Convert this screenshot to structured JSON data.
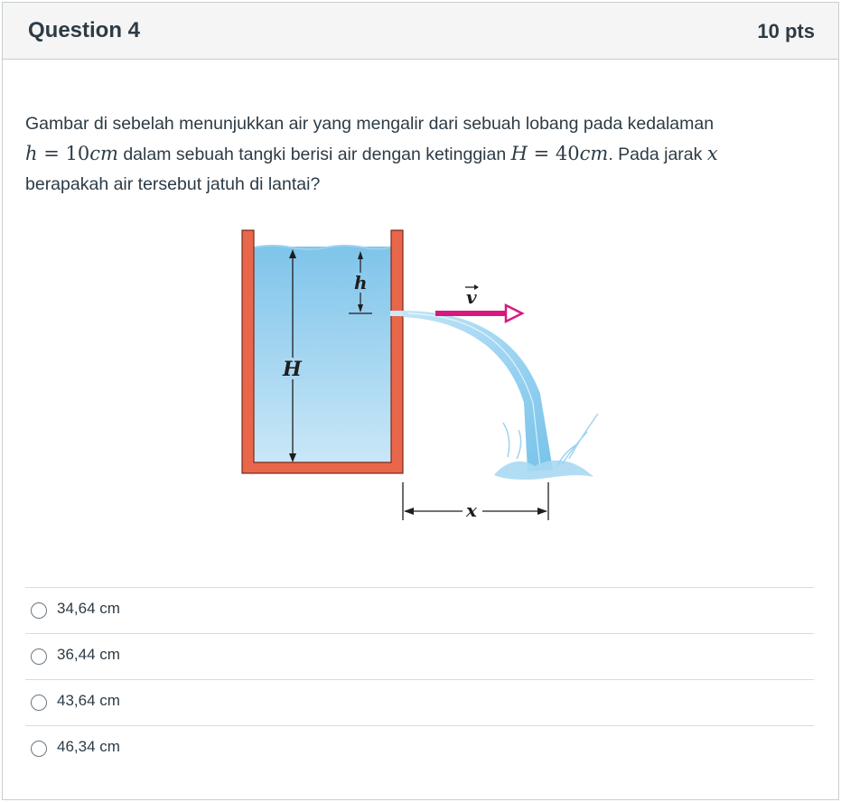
{
  "question": {
    "title": "Question 4",
    "points": "10 pts",
    "text_part1": "Gambar di sebelah menunjukkan air yang mengalir dari sebuah lobang pada kedalaman",
    "math_h_var": "h",
    "math_eq": " = ",
    "math_h_val": "10",
    "math_unit": "cm",
    "text_part2": " dalam sebuah tangki berisi air dengan ketinggian ",
    "math_H_var": "H",
    "math_H_val": "40",
    "text_part3": ". Pada jarak ",
    "math_x_var": "x",
    "text_part4": "berapakah air tersebut jatuh di lantai?"
  },
  "figure": {
    "label_H": "H",
    "label_h": "h",
    "label_v": "v",
    "label_x": "x",
    "colors": {
      "tank_wall": "#e8674a",
      "water_top": "#7fc4ea",
      "water_bottom": "#cde9f8",
      "arrow_v": "#d6197f"
    }
  },
  "answers": [
    {
      "label": "34,64 cm"
    },
    {
      "label": "36,44 cm"
    },
    {
      "label": "43,64 cm"
    },
    {
      "label": "46,34 cm"
    }
  ]
}
